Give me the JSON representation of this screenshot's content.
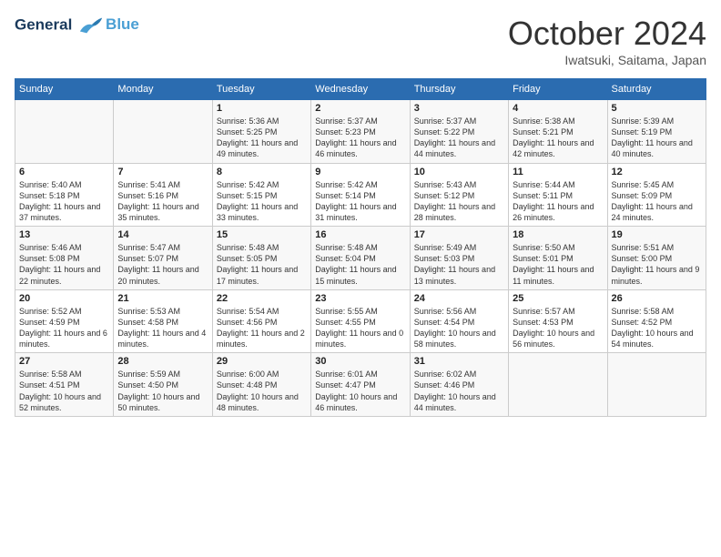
{
  "header": {
    "logo_line1": "General",
    "logo_line2": "Blue",
    "month": "October 2024",
    "location": "Iwatsuki, Saitama, Japan"
  },
  "weekdays": [
    "Sunday",
    "Monday",
    "Tuesday",
    "Wednesday",
    "Thursday",
    "Friday",
    "Saturday"
  ],
  "weeks": [
    [
      {
        "day": "",
        "info": ""
      },
      {
        "day": "",
        "info": ""
      },
      {
        "day": "1",
        "info": "Sunrise: 5:36 AM\nSunset: 5:25 PM\nDaylight: 11 hours and 49 minutes."
      },
      {
        "day": "2",
        "info": "Sunrise: 5:37 AM\nSunset: 5:23 PM\nDaylight: 11 hours and 46 minutes."
      },
      {
        "day": "3",
        "info": "Sunrise: 5:37 AM\nSunset: 5:22 PM\nDaylight: 11 hours and 44 minutes."
      },
      {
        "day": "4",
        "info": "Sunrise: 5:38 AM\nSunset: 5:21 PM\nDaylight: 11 hours and 42 minutes."
      },
      {
        "day": "5",
        "info": "Sunrise: 5:39 AM\nSunset: 5:19 PM\nDaylight: 11 hours and 40 minutes."
      }
    ],
    [
      {
        "day": "6",
        "info": "Sunrise: 5:40 AM\nSunset: 5:18 PM\nDaylight: 11 hours and 37 minutes."
      },
      {
        "day": "7",
        "info": "Sunrise: 5:41 AM\nSunset: 5:16 PM\nDaylight: 11 hours and 35 minutes."
      },
      {
        "day": "8",
        "info": "Sunrise: 5:42 AM\nSunset: 5:15 PM\nDaylight: 11 hours and 33 minutes."
      },
      {
        "day": "9",
        "info": "Sunrise: 5:42 AM\nSunset: 5:14 PM\nDaylight: 11 hours and 31 minutes."
      },
      {
        "day": "10",
        "info": "Sunrise: 5:43 AM\nSunset: 5:12 PM\nDaylight: 11 hours and 28 minutes."
      },
      {
        "day": "11",
        "info": "Sunrise: 5:44 AM\nSunset: 5:11 PM\nDaylight: 11 hours and 26 minutes."
      },
      {
        "day": "12",
        "info": "Sunrise: 5:45 AM\nSunset: 5:09 PM\nDaylight: 11 hours and 24 minutes."
      }
    ],
    [
      {
        "day": "13",
        "info": "Sunrise: 5:46 AM\nSunset: 5:08 PM\nDaylight: 11 hours and 22 minutes."
      },
      {
        "day": "14",
        "info": "Sunrise: 5:47 AM\nSunset: 5:07 PM\nDaylight: 11 hours and 20 minutes."
      },
      {
        "day": "15",
        "info": "Sunrise: 5:48 AM\nSunset: 5:05 PM\nDaylight: 11 hours and 17 minutes."
      },
      {
        "day": "16",
        "info": "Sunrise: 5:48 AM\nSunset: 5:04 PM\nDaylight: 11 hours and 15 minutes."
      },
      {
        "day": "17",
        "info": "Sunrise: 5:49 AM\nSunset: 5:03 PM\nDaylight: 11 hours and 13 minutes."
      },
      {
        "day": "18",
        "info": "Sunrise: 5:50 AM\nSunset: 5:01 PM\nDaylight: 11 hours and 11 minutes."
      },
      {
        "day": "19",
        "info": "Sunrise: 5:51 AM\nSunset: 5:00 PM\nDaylight: 11 hours and 9 minutes."
      }
    ],
    [
      {
        "day": "20",
        "info": "Sunrise: 5:52 AM\nSunset: 4:59 PM\nDaylight: 11 hours and 6 minutes."
      },
      {
        "day": "21",
        "info": "Sunrise: 5:53 AM\nSunset: 4:58 PM\nDaylight: 11 hours and 4 minutes."
      },
      {
        "day": "22",
        "info": "Sunrise: 5:54 AM\nSunset: 4:56 PM\nDaylight: 11 hours and 2 minutes."
      },
      {
        "day": "23",
        "info": "Sunrise: 5:55 AM\nSunset: 4:55 PM\nDaylight: 11 hours and 0 minutes."
      },
      {
        "day": "24",
        "info": "Sunrise: 5:56 AM\nSunset: 4:54 PM\nDaylight: 10 hours and 58 minutes."
      },
      {
        "day": "25",
        "info": "Sunrise: 5:57 AM\nSunset: 4:53 PM\nDaylight: 10 hours and 56 minutes."
      },
      {
        "day": "26",
        "info": "Sunrise: 5:58 AM\nSunset: 4:52 PM\nDaylight: 10 hours and 54 minutes."
      }
    ],
    [
      {
        "day": "27",
        "info": "Sunrise: 5:58 AM\nSunset: 4:51 PM\nDaylight: 10 hours and 52 minutes."
      },
      {
        "day": "28",
        "info": "Sunrise: 5:59 AM\nSunset: 4:50 PM\nDaylight: 10 hours and 50 minutes."
      },
      {
        "day": "29",
        "info": "Sunrise: 6:00 AM\nSunset: 4:48 PM\nDaylight: 10 hours and 48 minutes."
      },
      {
        "day": "30",
        "info": "Sunrise: 6:01 AM\nSunset: 4:47 PM\nDaylight: 10 hours and 46 minutes."
      },
      {
        "day": "31",
        "info": "Sunrise: 6:02 AM\nSunset: 4:46 PM\nDaylight: 10 hours and 44 minutes."
      },
      {
        "day": "",
        "info": ""
      },
      {
        "day": "",
        "info": ""
      }
    ]
  ]
}
